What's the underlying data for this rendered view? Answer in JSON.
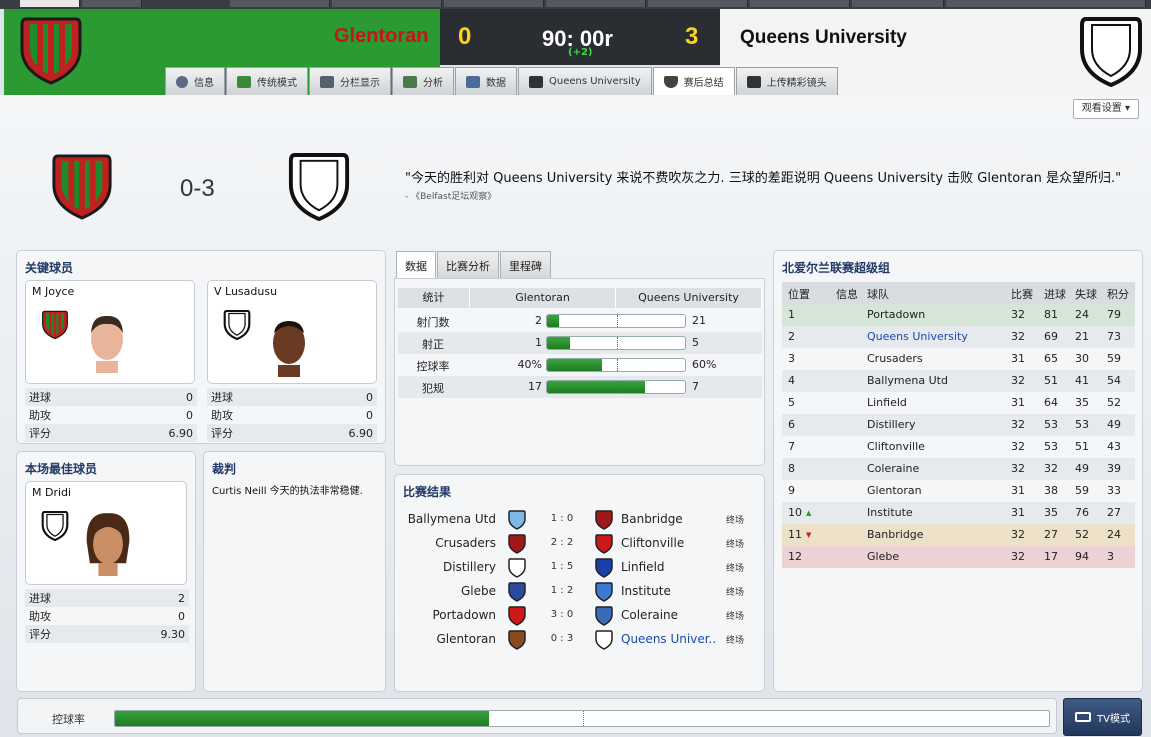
{
  "header": {
    "home_team": "Glentoran",
    "home_score": "0",
    "clock": "90: 00r",
    "stoppage": "(+2)",
    "away_score": "3",
    "away_team": "Queens University",
    "home_color": "#2b9a32",
    "home_text_color": "#c01818",
    "score_color": "#ffd21a"
  },
  "tabs": [
    {
      "label": "信息",
      "icon": "info-icon"
    },
    {
      "label": "传统模式",
      "icon": "pitch-icon"
    },
    {
      "label": "分栏显示",
      "icon": "split-view-icon"
    },
    {
      "label": "分析",
      "icon": "analysis-icon"
    },
    {
      "label": "数据",
      "icon": "stats-icon"
    },
    {
      "label": "Queens University",
      "icon": "team-icon"
    },
    {
      "label": "赛后总结",
      "icon": "shield-icon"
    },
    {
      "label": "上传精彩镜头",
      "icon": "camera-icon"
    }
  ],
  "view_settings": "观看设置",
  "summary": {
    "score": "0-3",
    "quote": "\"今天的胜利对 Queens University 来说不费吹灰之力. 三球的差距说明 Queens University 击败 Glentoran 是众望所归.\"",
    "source": "- 《Belfast足坛观察》"
  },
  "key_players": {
    "title": "关键球员",
    "players": [
      {
        "name": "M Joyce",
        "rows": [
          {
            "label": "进球",
            "value": "0"
          },
          {
            "label": "助攻",
            "value": "0"
          },
          {
            "label": "评分",
            "value": "6.90"
          }
        ]
      },
      {
        "name": "V Lusadusu",
        "rows": [
          {
            "label": "进球",
            "value": "0"
          },
          {
            "label": "助攻",
            "value": "0"
          },
          {
            "label": "评分",
            "value": "6.90"
          }
        ]
      }
    ]
  },
  "motm": {
    "title": "本场最佳球员",
    "name": "M Dridi",
    "rows": [
      {
        "label": "进球",
        "value": "2"
      },
      {
        "label": "助攻",
        "value": "0"
      },
      {
        "label": "评分",
        "value": "9.30"
      }
    ]
  },
  "referee": {
    "title": "裁判",
    "text": "Curtis Neill 今天的执法非常稳健."
  },
  "stats": {
    "tabs": [
      "数据",
      "比赛分析",
      "里程碑"
    ],
    "headers": [
      "统计",
      "Glentoran",
      "Queens University"
    ],
    "rows": [
      {
        "label": "射门数",
        "home": "2",
        "away": "21",
        "home_share": 0.087
      },
      {
        "label": "射正",
        "home": "1",
        "away": "5",
        "home_share": 0.167
      },
      {
        "label": "控球率",
        "home": "40%",
        "away": "60%",
        "home_share": 0.4
      },
      {
        "label": "犯规",
        "home": "17",
        "away": "7",
        "home_share": 0.708
      }
    ]
  },
  "results": {
    "title": "比赛结果",
    "rows": [
      {
        "home": "Ballymena Utd",
        "score": "1 : 0",
        "away": "Banbridge",
        "status": "终场",
        "hc": "#7fb8e6",
        "ac": "#a01818"
      },
      {
        "home": "Crusaders",
        "score": "2 : 2",
        "away": "Cliftonville",
        "status": "终场",
        "hc": "#a01818",
        "ac": "#cc1a1a"
      },
      {
        "home": "Distillery",
        "score": "1 : 5",
        "away": "Linfield",
        "status": "终场",
        "hc": "#ffffff",
        "ac": "#1a3fa8"
      },
      {
        "home": "Glebe",
        "score": "1 : 2",
        "away": "Institute",
        "status": "终场",
        "hc": "#2a4aa0",
        "ac": "#3a7ad0"
      },
      {
        "home": "Portadown",
        "score": "3 : 0",
        "away": "Coleraine",
        "status": "终场",
        "hc": "#d01818",
        "ac": "#3a6ab8"
      },
      {
        "home": "Glentoran",
        "score": "0 : 3",
        "away": "Queens Univer..",
        "status": "终场",
        "hc": "#8a4a20",
        "ac": "#ffffff"
      }
    ]
  },
  "league": {
    "title": "北爱尔兰联赛超级组",
    "headers": [
      "位置",
      "信息",
      "球队",
      "比赛",
      "进球",
      "失球",
      "积分"
    ],
    "rows": [
      {
        "pos": "1",
        "info": "",
        "team": "Portadown",
        "p": "32",
        "gf": "81",
        "ga": "24",
        "pts": "79"
      },
      {
        "pos": "2",
        "info": "",
        "team": "Queens University",
        "p": "32",
        "gf": "69",
        "ga": "21",
        "pts": "73"
      },
      {
        "pos": "3",
        "info": "",
        "team": "Crusaders",
        "p": "31",
        "gf": "65",
        "ga": "30",
        "pts": "59"
      },
      {
        "pos": "4",
        "info": "",
        "team": "Ballymena Utd",
        "p": "32",
        "gf": "51",
        "ga": "41",
        "pts": "54"
      },
      {
        "pos": "5",
        "info": "",
        "team": "Linfield",
        "p": "31",
        "gf": "64",
        "ga": "35",
        "pts": "52"
      },
      {
        "pos": "6",
        "info": "",
        "team": "Distillery",
        "p": "32",
        "gf": "53",
        "ga": "53",
        "pts": "49"
      },
      {
        "pos": "7",
        "info": "",
        "team": "Cliftonville",
        "p": "32",
        "gf": "53",
        "ga": "51",
        "pts": "43"
      },
      {
        "pos": "8",
        "info": "",
        "team": "Coleraine",
        "p": "32",
        "gf": "32",
        "ga": "49",
        "pts": "39"
      },
      {
        "pos": "9",
        "info": "",
        "team": "Glentoran",
        "p": "31",
        "gf": "38",
        "ga": "59",
        "pts": "33"
      },
      {
        "pos": "10",
        "info": "",
        "team": "Institute",
        "p": "31",
        "gf": "35",
        "ga": "76",
        "pts": "27"
      },
      {
        "pos": "11",
        "info": "",
        "team": "Banbridge",
        "p": "32",
        "gf": "27",
        "ga": "52",
        "pts": "24"
      },
      {
        "pos": "12",
        "info": "",
        "team": "Glebe",
        "p": "32",
        "gf": "17",
        "ga": "94",
        "pts": "3"
      }
    ]
  },
  "possession": {
    "label": "控球率",
    "home_share": 0.4
  },
  "tv_button": "TV模式"
}
